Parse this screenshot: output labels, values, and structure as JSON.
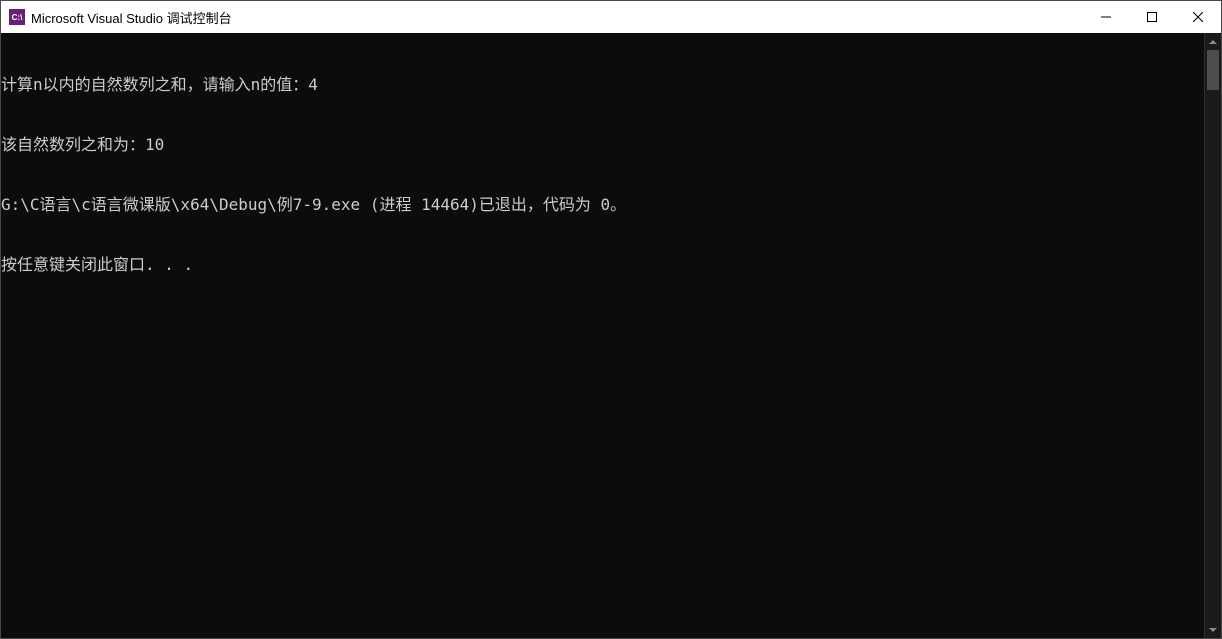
{
  "window": {
    "title": "Microsoft Visual Studio 调试控制台",
    "icon_label": "C:\\"
  },
  "console": {
    "lines": [
      "计算n以内的自然数列之和，请输入n的值：4",
      "该自然数列之和为：10",
      "G:\\C语言\\c语言微课版\\x64\\Debug\\例7-9.exe (进程 14464)已退出，代码为 0。",
      "按任意键关闭此窗口. . ."
    ]
  }
}
